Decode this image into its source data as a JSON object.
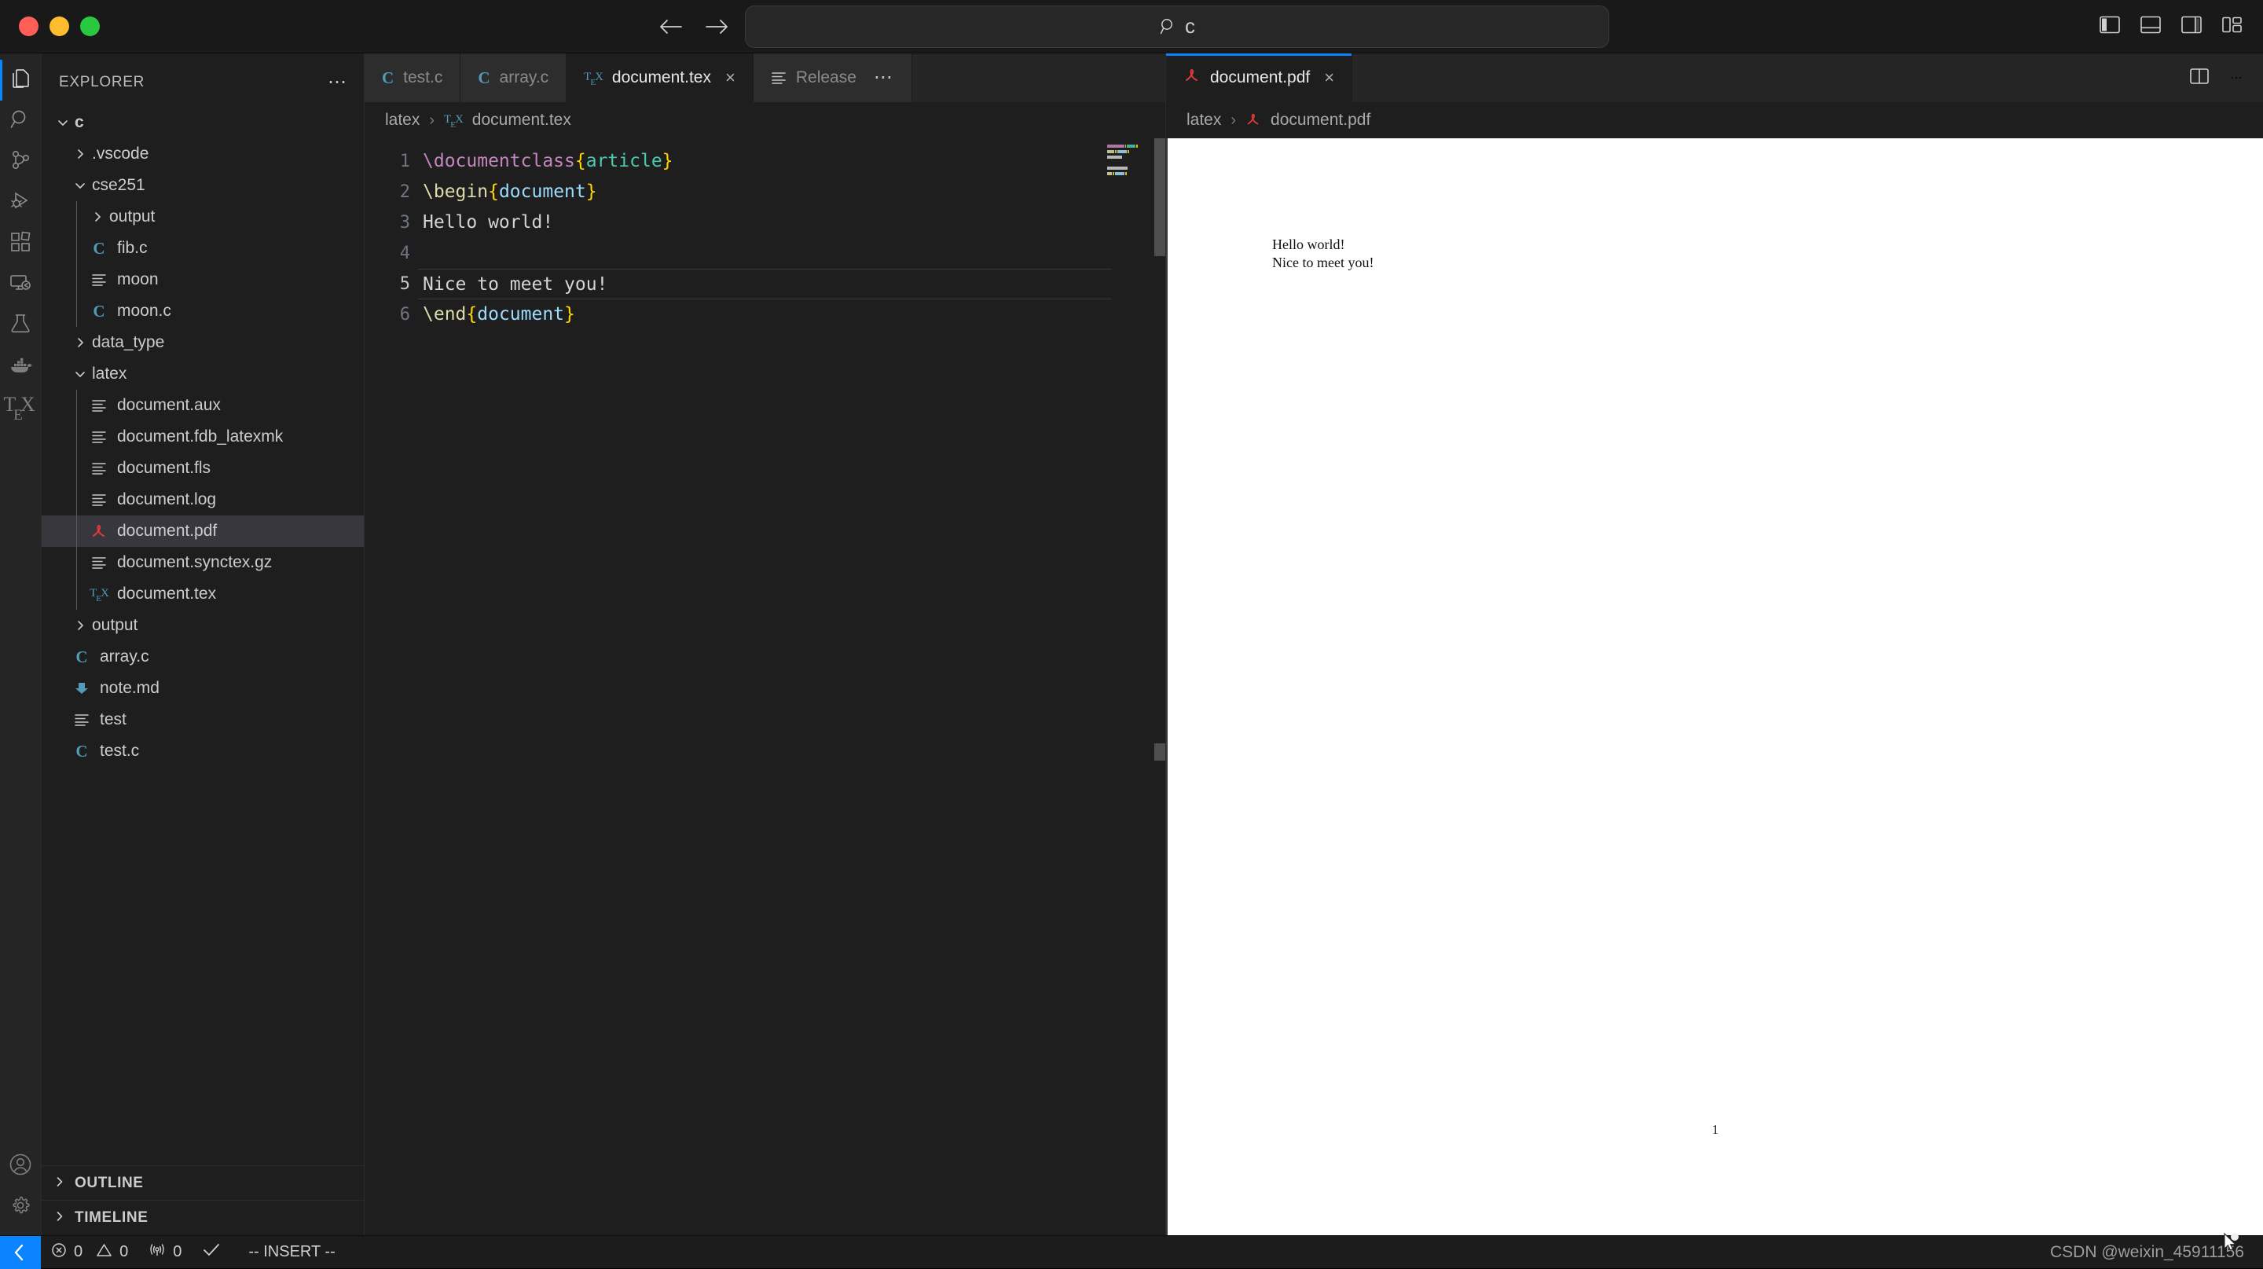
{
  "window": {
    "traffic_lights": [
      "close",
      "minimize",
      "maximize"
    ],
    "colors": {
      "red": "#ff5f57",
      "yellow": "#febc2e",
      "green": "#28c840",
      "accent": "#0a84ff"
    }
  },
  "titlebar": {
    "back_label": "Back",
    "forward_label": "Forward",
    "command_bar": {
      "value": "c",
      "placeholder": "Search",
      "icon": "search-icon"
    },
    "layout_toggles": [
      {
        "name": "toggle-primary-sidebar",
        "label": "Toggle Primary Side Bar"
      },
      {
        "name": "toggle-panel",
        "label": "Toggle Panel"
      },
      {
        "name": "toggle-secondary-sidebar",
        "label": "Toggle Secondary Side Bar"
      },
      {
        "name": "customize-layout",
        "label": "Customize Layout"
      }
    ]
  },
  "activitybar": {
    "items": [
      {
        "name": "explorer",
        "label": "Explorer",
        "icon": "files-icon",
        "active": true
      },
      {
        "name": "search",
        "label": "Search",
        "icon": "search-icon",
        "active": false
      },
      {
        "name": "source-control",
        "label": "Source Control",
        "icon": "source-control-icon",
        "active": false
      },
      {
        "name": "run-debug",
        "label": "Run and Debug",
        "icon": "debug-icon",
        "active": false
      },
      {
        "name": "extensions",
        "label": "Extensions",
        "icon": "extensions-icon",
        "active": false
      },
      {
        "name": "remote-explorer",
        "label": "Remote Explorer",
        "icon": "remote-icon",
        "active": false
      },
      {
        "name": "testing",
        "label": "Testing",
        "icon": "beaker-icon",
        "active": false
      },
      {
        "name": "docker",
        "label": "Docker",
        "icon": "whale-icon",
        "active": false
      },
      {
        "name": "latex",
        "label": "LaTeX",
        "icon": "tex-icon",
        "active": false
      }
    ],
    "bottom_items": [
      {
        "name": "accounts",
        "label": "Accounts",
        "icon": "account-icon"
      },
      {
        "name": "settings",
        "label": "Manage",
        "icon": "gear-icon"
      }
    ]
  },
  "sidebar": {
    "title": "EXPLORER",
    "more_actions": "⋯",
    "tree": [
      {
        "label": "c",
        "depth": 0,
        "type": "folder",
        "expanded": true,
        "icon": "chevron-down-icon",
        "bold": true
      },
      {
        "label": ".vscode",
        "depth": 1,
        "type": "folder",
        "expanded": false,
        "icon": "chevron-right-icon"
      },
      {
        "label": "cse251",
        "depth": 1,
        "type": "folder",
        "expanded": true,
        "icon": "chevron-down-icon"
      },
      {
        "label": "output",
        "depth": 2,
        "type": "folder",
        "expanded": false,
        "icon": "chevron-right-icon"
      },
      {
        "label": "fib.c",
        "depth": 2,
        "type": "file",
        "icon": "c-file-icon"
      },
      {
        "label": "moon",
        "depth": 2,
        "type": "file",
        "icon": "plain-file-icon"
      },
      {
        "label": "moon.c",
        "depth": 2,
        "type": "file",
        "icon": "c-file-icon"
      },
      {
        "label": "data_type",
        "depth": 1,
        "type": "folder",
        "expanded": false,
        "icon": "chevron-right-icon"
      },
      {
        "label": "latex",
        "depth": 1,
        "type": "folder",
        "expanded": true,
        "icon": "chevron-down-icon"
      },
      {
        "label": "document.aux",
        "depth": 2,
        "type": "file",
        "icon": "plain-file-icon"
      },
      {
        "label": "document.fdb_latexmk",
        "depth": 2,
        "type": "file",
        "icon": "plain-file-icon"
      },
      {
        "label": "document.fls",
        "depth": 2,
        "type": "file",
        "icon": "plain-file-icon"
      },
      {
        "label": "document.log",
        "depth": 2,
        "type": "file",
        "icon": "plain-file-icon"
      },
      {
        "label": "document.pdf",
        "depth": 2,
        "type": "file",
        "icon": "pdf-file-icon",
        "selected": true
      },
      {
        "label": "document.synctex.gz",
        "depth": 2,
        "type": "file",
        "icon": "plain-file-icon"
      },
      {
        "label": "document.tex",
        "depth": 2,
        "type": "file",
        "icon": "tex-file-icon"
      },
      {
        "label": "output",
        "depth": 1,
        "type": "folder",
        "expanded": false,
        "icon": "chevron-right-icon"
      },
      {
        "label": "array.c",
        "depth": 1,
        "type": "file",
        "icon": "c-file-icon"
      },
      {
        "label": "note.md",
        "depth": 1,
        "type": "file",
        "icon": "md-file-icon"
      },
      {
        "label": "test",
        "depth": 1,
        "type": "file",
        "icon": "plain-file-icon"
      },
      {
        "label": "test.c",
        "depth": 1,
        "type": "file",
        "icon": "c-file-icon"
      }
    ],
    "panels": [
      {
        "label": "OUTLINE",
        "expanded": false,
        "icon": "chevron-right-icon"
      },
      {
        "label": "TIMELINE",
        "expanded": false,
        "icon": "chevron-right-icon"
      }
    ]
  },
  "editor_group_1": {
    "tabs": [
      {
        "label": "test.c",
        "icon": "c-file-icon",
        "active": false,
        "dirty": false
      },
      {
        "label": "array.c",
        "icon": "c-file-icon",
        "active": false,
        "dirty": false
      },
      {
        "label": "document.tex",
        "icon": "tex-file-icon",
        "active": true,
        "close": "×"
      },
      {
        "label": "Release",
        "icon": "plain-file-icon",
        "active": false,
        "more": "⋯"
      }
    ],
    "breadcrumb": [
      {
        "label": "latex",
        "icon": null
      },
      {
        "label": "document.tex",
        "icon": "tex-file-icon"
      }
    ],
    "breadcrumb_separator": "›",
    "code": {
      "language": "latex",
      "active_line": 5,
      "lines": [
        {
          "n": 1,
          "tokens": [
            {
              "t": "\\documentclass",
              "c": "tok-cmd"
            },
            {
              "t": "{",
              "c": "tok-brace"
            },
            {
              "t": "article",
              "c": "tok-arg"
            },
            {
              "t": "}",
              "c": "tok-brace"
            }
          ]
        },
        {
          "n": 2,
          "tokens": [
            {
              "t": "\\begin",
              "c": "tok-cmd2"
            },
            {
              "t": "{",
              "c": "tok-brace"
            },
            {
              "t": "document",
              "c": "tok-arg2"
            },
            {
              "t": "}",
              "c": "tok-brace"
            }
          ]
        },
        {
          "n": 3,
          "tokens": [
            {
              "t": "Hello world!",
              "c": "tok-plain"
            }
          ]
        },
        {
          "n": 4,
          "tokens": [
            {
              "t": "",
              "c": "tok-plain"
            }
          ]
        },
        {
          "n": 5,
          "tokens": [
            {
              "t": "Nice to meet you!",
              "c": "tok-plain"
            }
          ]
        },
        {
          "n": 6,
          "tokens": [
            {
              "t": "\\end",
              "c": "tok-cmd2"
            },
            {
              "t": "{",
              "c": "tok-brace"
            },
            {
              "t": "document",
              "c": "tok-arg2"
            },
            {
              "t": "}",
              "c": "tok-brace"
            }
          ]
        }
      ]
    }
  },
  "editor_group_2": {
    "tabs": [
      {
        "label": "document.pdf",
        "icon": "pdf-file-icon",
        "active": true,
        "close": "×"
      }
    ],
    "actions": [
      {
        "name": "split-editor",
        "label": "Split Editor"
      },
      {
        "name": "more-actions",
        "label": "More Actions",
        "glyph": "⋯"
      }
    ],
    "breadcrumb": [
      {
        "label": "latex",
        "icon": null
      },
      {
        "label": "document.pdf",
        "icon": "pdf-file-icon"
      }
    ],
    "breadcrumb_separator": "›",
    "pdf": {
      "lines": [
        "Hello world!",
        "Nice to meet you!"
      ],
      "page_number": "1"
    }
  },
  "statusbar": {
    "remote_label": "Remote",
    "items": [
      {
        "name": "problems-errors",
        "icon": "error-icon",
        "value": "0"
      },
      {
        "name": "problems-warnings",
        "icon": "warning-icon",
        "value": "0"
      },
      {
        "name": "ports",
        "icon": "radio-tower-icon",
        "value": "0"
      },
      {
        "name": "latex-build-status",
        "icon": "check-icon",
        "value": ""
      },
      {
        "name": "vim-mode",
        "icon": null,
        "value": "-- INSERT --"
      }
    ],
    "watermark": "CSDN @weixin_45911156"
  }
}
